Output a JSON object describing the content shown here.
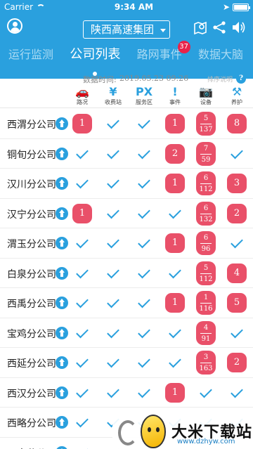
{
  "status_bar": {
    "carrier": "Carrier",
    "time": "9:34 AM"
  },
  "header": {
    "company": "陕西高速集团"
  },
  "tabs": [
    {
      "label": "运行监测",
      "active": false
    },
    {
      "label": "公司列表",
      "active": true
    },
    {
      "label": "路网事件",
      "active": false,
      "badge": "37"
    },
    {
      "label": "数据大脑",
      "active": false
    }
  ],
  "timebar": {
    "label": "数据时间:",
    "value": "2019.05.23 09:26",
    "help": "排序说明",
    "help_icon": "?"
  },
  "columns": [
    {
      "label": "路况",
      "glyph": "🚗"
    },
    {
      "label": "收费站",
      "glyph": "¥"
    },
    {
      "label": "服务区",
      "glyph": "PX"
    },
    {
      "label": "事件",
      "glyph": "!"
    },
    {
      "label": "设备",
      "glyph": "📷"
    },
    {
      "label": "养护",
      "glyph": "⚒"
    }
  ],
  "rows": [
    {
      "name": "西渭分公司",
      "cells": [
        "1",
        "ok",
        "ok",
        "1",
        "5/137",
        "8"
      ]
    },
    {
      "name": "铜旬分公司",
      "cells": [
        "ok",
        "ok",
        "ok",
        "2",
        "7/59",
        "ok"
      ]
    },
    {
      "name": "汉川分公司",
      "cells": [
        "ok",
        "ok",
        "ok",
        "1",
        "6/112",
        "3"
      ]
    },
    {
      "name": "汉宁分公司",
      "cells": [
        "1",
        "ok",
        "ok",
        "ok",
        "6/132",
        "2"
      ]
    },
    {
      "name": "渭玉分公司",
      "cells": [
        "ok",
        "ok",
        "ok",
        "1",
        "6/96",
        "ok"
      ]
    },
    {
      "name": "白泉分公司",
      "cells": [
        "ok",
        "ok",
        "ok",
        "ok",
        "5/112",
        "4"
      ]
    },
    {
      "name": "西禹分公司",
      "cells": [
        "ok",
        "ok",
        "ok",
        "1",
        "1/116",
        "5"
      ]
    },
    {
      "name": "宝鸡分公司",
      "cells": [
        "ok",
        "ok",
        "ok",
        "ok",
        "4/91",
        "ok"
      ]
    },
    {
      "name": "西延分公司",
      "cells": [
        "ok",
        "ok",
        "ok",
        "ok",
        "3/163",
        "2"
      ]
    },
    {
      "name": "西汉分公司",
      "cells": [
        "ok",
        "ok",
        "ok",
        "1",
        "ok",
        "ok"
      ]
    },
    {
      "name": "西略分公司",
      "cells": [
        "ok",
        "ok",
        "ok",
        "ok",
        "ok",
        "ok"
      ]
    },
    {
      "name": "西户分公司",
      "cells": [
        "ok",
        "ok",
        "ok",
        "ok",
        "ok",
        "ok"
      ]
    }
  ],
  "watermark": {
    "title": "大米下载站",
    "url": "www.dzhyw.com"
  },
  "colors": {
    "primary": "#2aa0de",
    "alert": "#e95069",
    "badge": "#e8234a"
  }
}
